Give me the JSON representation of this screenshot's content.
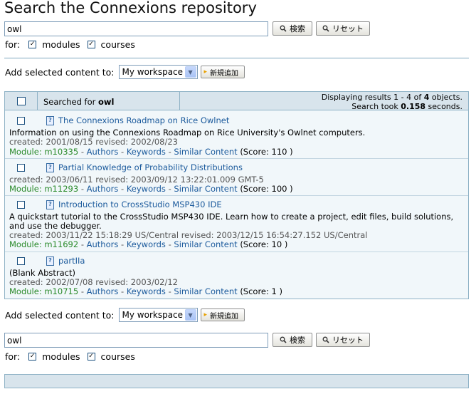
{
  "page_title": "Search the Connexions repository",
  "search": {
    "query": "owl",
    "search_button": "検索",
    "reset_button": "リセット"
  },
  "for_row": {
    "label": "for:",
    "modules": "modules",
    "courses": "courses"
  },
  "add_row": {
    "label": "Add selected content to:",
    "select_value": "My workspace",
    "new_button": "新規追加"
  },
  "results_header": {
    "searched_for_prefix": "Searched for",
    "searched_for_term": "owl",
    "displaying_prefix": "Displaying results 1 - 4 of",
    "total": "4",
    "displaying_suffix": "objects.",
    "took_prefix": "Search took",
    "seconds": "0.158",
    "took_suffix": "seconds."
  },
  "results": [
    {
      "title": "The Connexions Roadmap on Rice Owlnet",
      "abstract": "Information on using the Connexions Roadmap on Rice University's Owlnet computers.",
      "abstract2": "",
      "dates": "created: 2001/08/15 revised: 2002/08/23",
      "module_label": "Module:",
      "module_id": "m10335",
      "authors": "Authors",
      "keywords": "Keywords",
      "similar": "Similar Content",
      "score": "(Score: 110 )"
    },
    {
      "title": "Partial Knowledge of Probability Distributions",
      "abstract": "",
      "abstract2": "",
      "dates": "created: 2003/06/11 revised: 2003/09/12 13:22:01.009 GMT-5",
      "module_label": "Module:",
      "module_id": "m11293",
      "authors": "Authors",
      "keywords": "Keywords",
      "similar": "Similar Content",
      "score": "(Score: 100 )"
    },
    {
      "title": "Introduction to CrossStudio MSP430 IDE",
      "abstract": "A quickstart tutorial to the CrossStudio MSP430 IDE. Learn how to create a project, edit files, build solutions,",
      "abstract2": "and use the debugger.",
      "dates": "created: 2003/11/22 15:18:29 US/Central revised: 2003/12/15 16:54:27.152 US/Central",
      "module_label": "Module:",
      "module_id": "m11692",
      "authors": "Authors",
      "keywords": "Keywords",
      "similar": "Similar Content",
      "score": "(Score: 10 )"
    },
    {
      "title": "partIIa",
      "abstract": "(Blank Abstract)",
      "abstract2": "",
      "dates": "created: 2002/07/08 revised: 2003/02/12",
      "module_label": "Module:",
      "module_id": "m10715",
      "authors": "Authors",
      "keywords": "Keywords",
      "similar": "Similar Content",
      "score": "(Score: 1 )"
    }
  ],
  "separator": "-",
  "icons": {
    "search": "magnifier-icon",
    "reset": "magnifier-icon",
    "document": "document-question-icon",
    "new": "new-item-icon"
  },
  "colors": {
    "link": "#1b5a9c",
    "module": "#2a8a2a",
    "header_bg": "#d8e4ec",
    "results_bg": "#f1f7fa",
    "border": "#8fb2c6"
  }
}
